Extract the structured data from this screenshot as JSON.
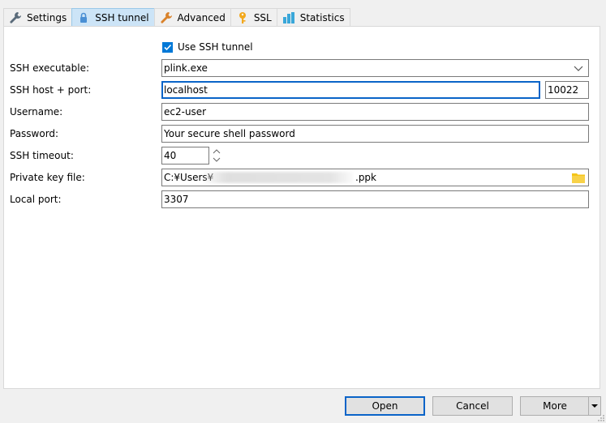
{
  "tabs": [
    {
      "label": "Settings",
      "icon": "wrench-icon",
      "active": false
    },
    {
      "label": "SSH tunnel",
      "icon": "lock-icon",
      "active": true
    },
    {
      "label": "Advanced",
      "icon": "wrench-orange-icon",
      "active": false
    },
    {
      "label": "SSL",
      "icon": "key-icon",
      "active": false
    },
    {
      "label": "Statistics",
      "icon": "bar-chart-icon",
      "active": false
    }
  ],
  "use_ssh": {
    "label": "Use SSH tunnel",
    "checked": true
  },
  "ssh_executable": {
    "label": "SSH executable:",
    "value": "plink.exe"
  },
  "ssh_host": {
    "label": "SSH host + port:",
    "host": "localhost",
    "port": "10022"
  },
  "username": {
    "label": "Username:",
    "value": "ec2-user"
  },
  "password": {
    "label": "Password:",
    "value": "Your secure shell password"
  },
  "timeout": {
    "label": "SSH timeout:",
    "value": "40"
  },
  "private_key": {
    "label": "Private key file:",
    "prefix": "C:¥Users¥",
    "suffix": ".ppk"
  },
  "local_port": {
    "label": "Local port:",
    "value": "3307"
  },
  "buttons": {
    "open": "Open",
    "cancel": "Cancel",
    "more": "More"
  },
  "colors": {
    "accent": "#0a64c8",
    "checkbox": "#0078d7",
    "folder": "#f5c518"
  }
}
